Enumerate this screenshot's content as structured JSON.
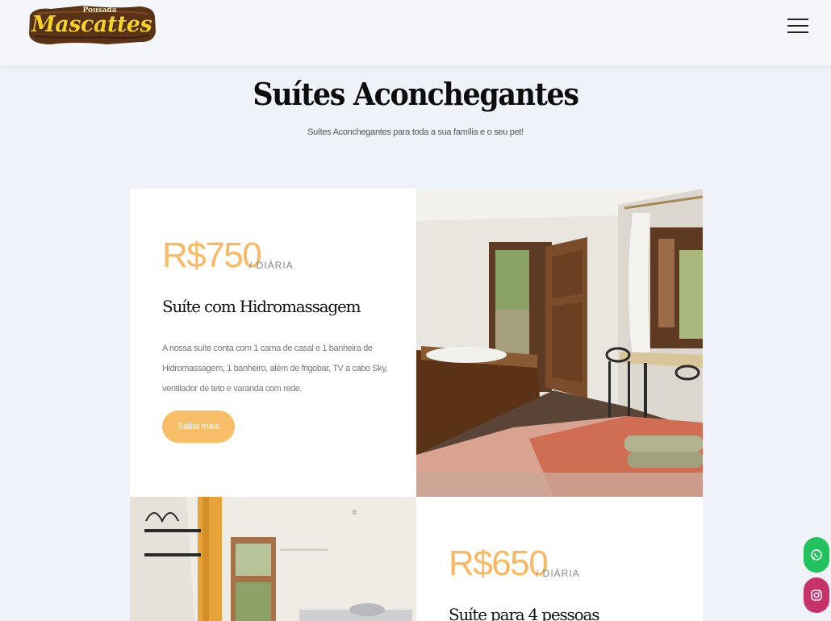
{
  "header": {
    "logo_small": "Pousada",
    "logo_main": "Mascattes"
  },
  "section": {
    "title": "Suítes Aconchegantes",
    "subtitle": "Suítes Aconchegantes para toda a sua família e o seu pet!"
  },
  "suites": [
    {
      "price": "R$750",
      "per": "/ DIÁRIA",
      "title": "Suíte com Hidromassagem",
      "description": "A nossa suíte conta com 1 cama de casal e 1 banheira de Hidromassagem, 1 banheiro, além de frigobar, TV a cabo Sky, ventilador de teto e varanda com rede.",
      "button": "Saiba mais"
    },
    {
      "price": "R$650",
      "per": "/ DIÁRIA",
      "title": "Suíte para 4 pessoas"
    }
  ],
  "floating": {
    "whatsapp_icon": "whatsapp-icon",
    "instagram_icon": "instagram-icon",
    "whatsapp_color": "#22c35e",
    "instagram_color": "#c8326b"
  },
  "colors": {
    "accent": "#f9b862",
    "background": "#eff3f9"
  }
}
